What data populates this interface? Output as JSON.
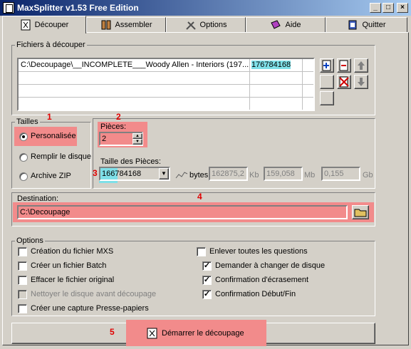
{
  "window": {
    "title": "MaxSplitter v1.53 Free Edition",
    "min": "_",
    "max": "□",
    "close": "×"
  },
  "tabs": [
    {
      "label": "Découper",
      "icon": "scissors-icon"
    },
    {
      "label": "Assembler",
      "icon": "join-icon"
    },
    {
      "label": "Options",
      "icon": "tools-icon"
    },
    {
      "label": "Aide",
      "icon": "help-book-icon"
    },
    {
      "label": "Quitter",
      "icon": "exit-icon"
    }
  ],
  "files": {
    "legend": "Fichiers à découper",
    "rows": [
      {
        "path": "C:\\Decoupage\\__INCOMPLETE___Woody Allen - Interiors (197...",
        "size": "176784168"
      }
    ]
  },
  "tailles": {
    "legend": "Tailles",
    "options": [
      "Personalisée",
      "Remplir le disque",
      "Archive ZIP"
    ],
    "selected": 0
  },
  "pieces": {
    "label": "Pièces:",
    "value": "2"
  },
  "taille_pieces": {
    "label": "Taille des Pièces:",
    "value": "166784168",
    "bytes_label": "bytes",
    "kb_value": "162875,2",
    "kb_unit": "Kb",
    "mb_value": "159,058",
    "mb_unit": "Mb",
    "gb_value": "0,155",
    "gb_unit": "Gb"
  },
  "destination": {
    "label": "Destination:",
    "value": "C:\\Decoupage"
  },
  "options": {
    "legend": "Options",
    "left": [
      {
        "label": "Création du fichier MXS",
        "checked": false,
        "disabled": false
      },
      {
        "label": "Créer un fichier Batch",
        "checked": false,
        "disabled": false
      },
      {
        "label": "Effacer le fichier original",
        "checked": false,
        "disabled": false
      },
      {
        "label": "Nettoyer le disque avant découpage",
        "checked": false,
        "disabled": true
      },
      {
        "label": "Créer une capture Presse-papiers",
        "checked": false,
        "disabled": false
      }
    ],
    "right": [
      {
        "label": "Enlever toutes les questions",
        "checked": false
      },
      {
        "label": "Demander à changer de disque",
        "checked": true
      },
      {
        "label": "Confirmation d'écrasement",
        "checked": true
      },
      {
        "label": "Confirmation Début/Fin",
        "checked": true
      }
    ]
  },
  "start_button": {
    "label": "Démarrer le découpage"
  },
  "annotations": [
    "1",
    "2",
    "3",
    "4",
    "5"
  ],
  "colors": {
    "highlight": "#f28b8b",
    "cyan": "#7fe0e8",
    "annotation": "#e00000",
    "title_bar": "#0a246a"
  }
}
